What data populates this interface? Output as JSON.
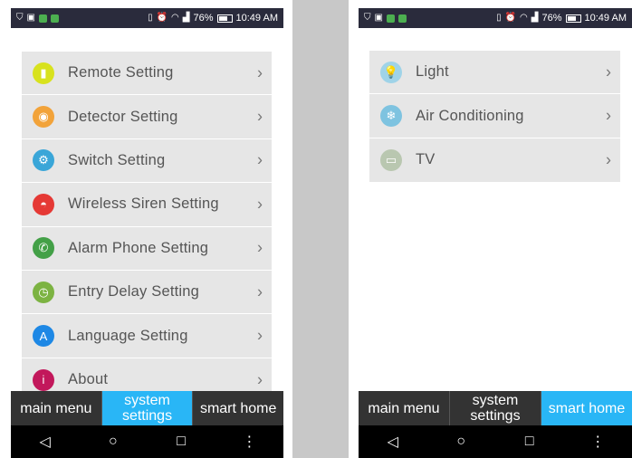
{
  "status_bar": {
    "battery_percent": "76%",
    "battery_level": 0.76,
    "time": "10:49 AM"
  },
  "left_screen": {
    "menu_items": [
      {
        "label": "Remote Setting",
        "icon": "remote-icon",
        "color": "#d8e21e",
        "glyph": "▮"
      },
      {
        "label": "Detector Setting",
        "icon": "detector-icon",
        "color": "#f2a33a",
        "glyph": "◉"
      },
      {
        "label": "Switch Setting",
        "icon": "gear-icon",
        "color": "#3aa6d8",
        "glyph": "⚙"
      },
      {
        "label": "Wireless Siren Setting",
        "icon": "siren-icon",
        "color": "#e53935",
        "glyph": "◓"
      },
      {
        "label": "Alarm Phone Setting",
        "icon": "phone-icon",
        "color": "#43a047",
        "glyph": "✆"
      },
      {
        "label": "Entry Delay Setting",
        "icon": "alarm-clock-icon",
        "color": "#7cb342",
        "glyph": "◷"
      },
      {
        "label": "Language Setting",
        "icon": "language-icon",
        "color": "#1e88e5",
        "glyph": "A"
      },
      {
        "label": "About",
        "icon": "about-icon",
        "color": "#c2185b",
        "glyph": "i"
      }
    ],
    "tabs": [
      {
        "label": "main menu",
        "active": false
      },
      {
        "label": "system settings",
        "active": true
      },
      {
        "label": "smart home",
        "active": false
      }
    ]
  },
  "right_screen": {
    "menu_items": [
      {
        "label": "Light",
        "icon": "lightbulb-icon",
        "color": "#9fd3e8",
        "glyph": "💡"
      },
      {
        "label": "Air Conditioning",
        "icon": "snowflake-icon",
        "color": "#7ec3e0",
        "glyph": "❄"
      },
      {
        "label": "TV",
        "icon": "tv-icon",
        "color": "#b9c7b0",
        "glyph": "▭"
      }
    ],
    "tabs": [
      {
        "label": "main menu",
        "active": false
      },
      {
        "label": "system settings",
        "active": false
      },
      {
        "label": "smart home",
        "active": true
      }
    ]
  },
  "nav_bar": {
    "back": "◁",
    "home": "○",
    "recents": "□",
    "more": "⋮"
  },
  "colors": {
    "status_bar_bg": "#2a2b3c",
    "tab_bar_bg": "#333333",
    "active_tab_bg": "#29b6f6",
    "menu_bg": "#e6e6e6"
  }
}
